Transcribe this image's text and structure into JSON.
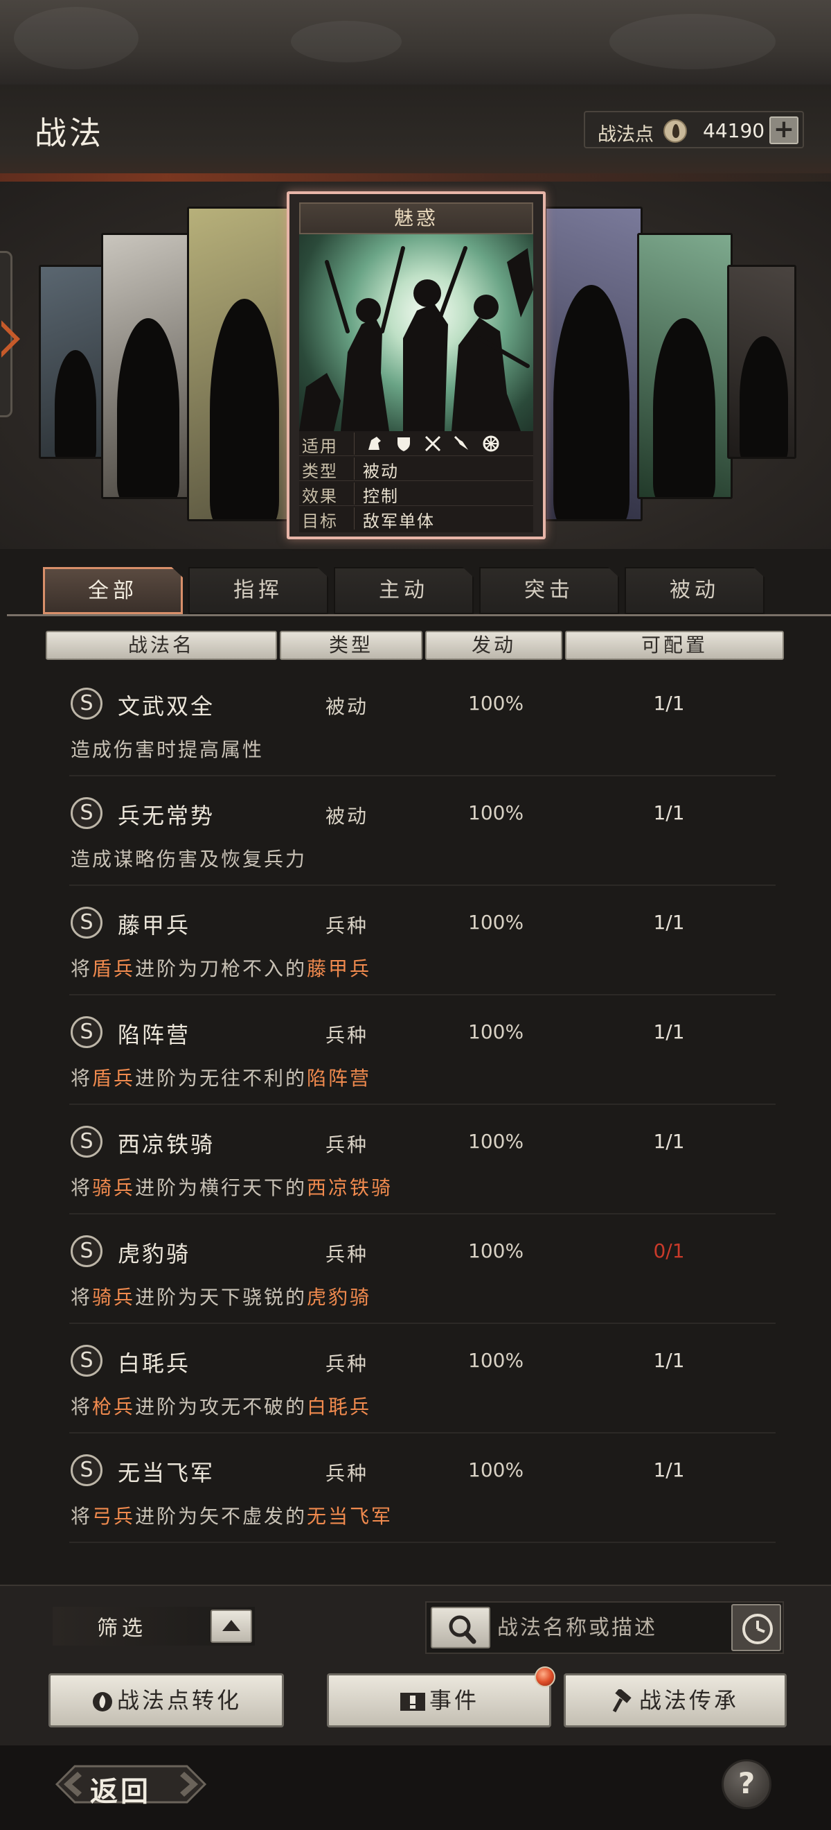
{
  "header": {
    "title": "战法",
    "points_label": "战法点",
    "points_value": "44190",
    "plus_label": "+"
  },
  "featured_card": {
    "title": "魅惑",
    "rows": [
      {
        "key": "适用",
        "value": ""
      },
      {
        "key": "类型",
        "value": "被动"
      },
      {
        "key": "效果",
        "value": "控制"
      },
      {
        "key": "目标",
        "value": "敌军单体"
      }
    ],
    "unit_icons": [
      "cavalry-icon",
      "shield-icon",
      "spear-crossed-icon",
      "bow-icon",
      "chariot-wheel-icon"
    ]
  },
  "tabs": [
    {
      "label": "全部",
      "active": true
    },
    {
      "label": "指挥",
      "active": false
    },
    {
      "label": "主动",
      "active": false
    },
    {
      "label": "突击",
      "active": false
    },
    {
      "label": "被动",
      "active": false
    }
  ],
  "columns": [
    "战法名",
    "类型",
    "发动",
    "可配置"
  ],
  "rows": [
    {
      "badge": "S",
      "name": "文武双全",
      "type": "被动",
      "rate": "100%",
      "slots": "1/1",
      "desc": [
        {
          "t": "造成伤害时提高属性",
          "h": false
        }
      ]
    },
    {
      "badge": "S",
      "name": "兵无常势",
      "type": "被动",
      "rate": "100%",
      "slots": "1/1",
      "desc": [
        {
          "t": "造成谋略伤害及恢复兵力",
          "h": false
        }
      ]
    },
    {
      "badge": "S",
      "name": "藤甲兵",
      "type": "兵种",
      "rate": "100%",
      "slots": "1/1",
      "desc": [
        {
          "t": "将",
          "h": false
        },
        {
          "t": "盾兵",
          "h": true
        },
        {
          "t": "进阶为刀枪不入的",
          "h": false
        },
        {
          "t": "藤甲兵",
          "h": true
        }
      ]
    },
    {
      "badge": "S",
      "name": "陷阵营",
      "type": "兵种",
      "rate": "100%",
      "slots": "1/1",
      "desc": [
        {
          "t": "将",
          "h": false
        },
        {
          "t": "盾兵",
          "h": true
        },
        {
          "t": "进阶为无往不利的",
          "h": false
        },
        {
          "t": "陷阵营",
          "h": true
        }
      ]
    },
    {
      "badge": "S",
      "name": "西凉铁骑",
      "type": "兵种",
      "rate": "100%",
      "slots": "1/1",
      "desc": [
        {
          "t": "将",
          "h": false
        },
        {
          "t": "骑兵",
          "h": true
        },
        {
          "t": "进阶为横行天下的",
          "h": false
        },
        {
          "t": "西凉铁骑",
          "h": true
        }
      ]
    },
    {
      "badge": "S",
      "name": "虎豹骑",
      "type": "兵种",
      "rate": "100%",
      "slots": "0/1",
      "slots_zero": true,
      "desc": [
        {
          "t": "将",
          "h": false
        },
        {
          "t": "骑兵",
          "h": true
        },
        {
          "t": "进阶为天下骁锐的",
          "h": false
        },
        {
          "t": "虎豹骑",
          "h": true
        }
      ]
    },
    {
      "badge": "S",
      "name": "白毦兵",
      "type": "兵种",
      "rate": "100%",
      "slots": "1/1",
      "desc": [
        {
          "t": "将",
          "h": false
        },
        {
          "t": "枪兵",
          "h": true
        },
        {
          "t": "进阶为攻无不破的",
          "h": false
        },
        {
          "t": "白毦兵",
          "h": true
        }
      ]
    },
    {
      "badge": "S",
      "name": "无当飞军",
      "type": "兵种",
      "rate": "100%",
      "slots": "1/1",
      "desc": [
        {
          "t": "将",
          "h": false
        },
        {
          "t": "弓兵",
          "h": true
        },
        {
          "t": "进阶为矢不虚发的",
          "h": false
        },
        {
          "t": "无当飞军",
          "h": true
        }
      ]
    }
  ],
  "filter": {
    "label": "筛选"
  },
  "search": {
    "placeholder": "战法名称或描述"
  },
  "buttons": {
    "convert": "战法点转化",
    "event": "事件",
    "inherit": "战法传承"
  },
  "footer": {
    "back": "返回",
    "help": "?"
  },
  "colors": {
    "accent": "#f08a4e",
    "zero_slots": "#c93a2a",
    "active_tab_border": "#d88f6a"
  }
}
